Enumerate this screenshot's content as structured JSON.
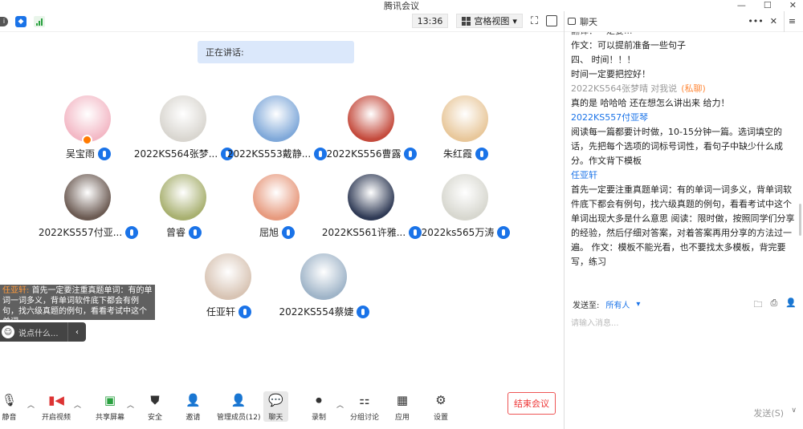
{
  "window": {
    "title": "腾讯会议",
    "minimize": "—",
    "restore": "☐",
    "close": "✕"
  },
  "topbar": {
    "time": "13:36",
    "view_label": "宫格视图"
  },
  "speaking": {
    "label": "正在讲话:"
  },
  "participants": [
    {
      "name": "吴宝雨",
      "color": "#f3b8c5"
    },
    {
      "name": "2022KS564张梦...",
      "color": "#d9d6d0"
    },
    {
      "name": "2022KS553戴静...",
      "color": "#7fa8d9"
    },
    {
      "name": "2022KS556曹露",
      "color": "#c44a3c"
    },
    {
      "name": "朱红霞",
      "color": "#e8c79a"
    },
    {
      "name": "2022KS557付亚...",
      "color": "#6b5a52"
    },
    {
      "name": "曾睿",
      "color": "#a8b070"
    },
    {
      "name": "屈旭",
      "color": "#e79a7e"
    },
    {
      "name": "2022KS561许雅...",
      "color": "#2f3a55"
    },
    {
      "name": "2022ks565万涛",
      "color": "#d7d7cf"
    },
    {
      "name": "任亚轩",
      "color": "#d8c4b4"
    },
    {
      "name": "2022KS554蔡婕",
      "color": "#9fb4c8"
    }
  ],
  "caption": {
    "who": "任亚轩:",
    "text": "首先一定要注重真题单词：有的单词一词多义，背单词软件底下都会有例句，找六级真题的例句，看看考试中这个单词..."
  },
  "saybar": {
    "placeholder": "说点什么...",
    "chevron": "‹"
  },
  "toolbar": {
    "mute": "静音",
    "video": "开启视频",
    "share": "共享屏幕",
    "security": "安全",
    "invite": "邀请",
    "members": "管理成员(12)",
    "chat": "聊天",
    "record": "录制",
    "breakout": "分组讨论",
    "apps": "应用",
    "settings": "设置",
    "end": "结束会议"
  },
  "chat": {
    "title": "聊天",
    "cut_line": "翻译：一定要...",
    "messages": [
      {
        "type": "text",
        "text": "作文：可以提前准备一些句子"
      },
      {
        "type": "text",
        "text": "四、    时间！！！"
      },
      {
        "type": "text",
        "text": "时间一定要把控好！"
      },
      {
        "type": "sender",
        "name": "2022KS564张梦晴",
        "extra": "对我说",
        "priv": "(私聊)"
      },
      {
        "type": "text",
        "text": "真的是  哈哈哈 还在想怎么讲出来   给力！"
      },
      {
        "type": "sender",
        "name": "2022KS557付亚琴"
      },
      {
        "type": "text",
        "text": "阅读每一篇都要计时做，10-15分钟一篇。选词填空的话，先把每个选项的词标号词性，看句子中缺少什么成分。作文背下模板"
      },
      {
        "type": "sender",
        "name": "任亚轩"
      },
      {
        "type": "text",
        "text": "首先一定要注重真题单词：有的单词一词多义，背单词软件底下都会有例句，找六级真题的例句，看看考试中这个单词出现大多是什么意思              阅读：限时做，按照同学们分享的经验，然后仔细对答案，对着答案再用分享的方法过一遍。          作文：模板不能光看，也不要找太多模板，背完要写，练习"
      }
    ],
    "send_to_label": "发送至:",
    "send_to_target": "所有人",
    "input_placeholder": "请输入消息...",
    "send_label": "发送(S)"
  }
}
